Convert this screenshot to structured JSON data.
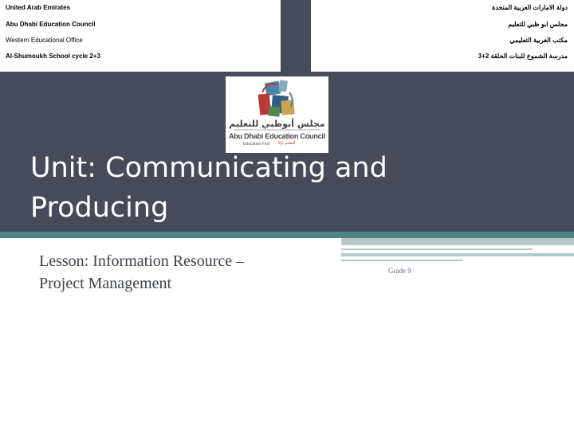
{
  "header": {
    "left_lines": [
      "United Arab Emirates",
      "Abu Dhabi Education Council",
      "Western Educational Office",
      "Al-Shumoukh School cycle 2+3"
    ],
    "right_lines": [
      "دولة الامارات العربية المتحدة",
      "مجلس ابو ظبي للتعليم",
      "مكتب الغربية التعليمي",
      "مدرسة الشموخ للبنات الحلقة 2+3"
    ]
  },
  "logo": {
    "arabic_name": "مجلس أبوظبي للتعليم",
    "english_name": "Abu Dhabi Education Council",
    "tagline": "Education First",
    "tagline_ar": "التعليم أولاً"
  },
  "title": {
    "line1": "Unit: Communicating and",
    "line2": "Producing"
  },
  "lesson": {
    "line1": "Lesson: Information Resource –",
    "line2": "Project Management"
  },
  "grade": "Grade 9",
  "colors": {
    "band": "#464a5a",
    "teal": "#4e8587",
    "stripe": "#b5c8c8",
    "text_dark": "#3e4150"
  }
}
